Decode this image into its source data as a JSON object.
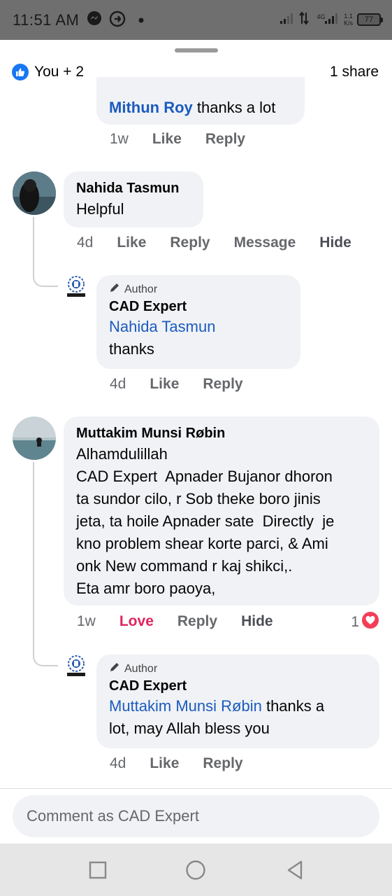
{
  "status_bar": {
    "time": "11:51 AM",
    "network": "4G",
    "speed_line1": "1.1",
    "speed_line2": "K/s",
    "battery": "77"
  },
  "reactions": {
    "summary": "You + 2",
    "shares": "1 share"
  },
  "top_reply": {
    "mention": "Mithun Roy",
    "text": " thanks a lot",
    "age": "1w",
    "like": "Like",
    "reply": "Reply"
  },
  "comments": [
    {
      "author": "Nahida Tasmun",
      "text": "Helpful",
      "age": "4d",
      "like": "Like",
      "reply": "Reply",
      "message": "Message",
      "hide": "Hide",
      "reply_item": {
        "badge": "Author",
        "author": "CAD Expert",
        "mention": "Nahida Tasmun",
        "text": "thanks",
        "age": "4d",
        "like": "Like",
        "reply": "Reply"
      }
    },
    {
      "author": "Muttakim Munsi Røbin",
      "lines": [
        "Alhamdulillah",
        "CAD Expert  Apnader Bujanor dhoron",
        "ta sundor cilo, r Sob theke boro jinis",
        "jeta, ta hoile Apnader sate  Directly  je",
        "kno problem shear korte parci, & Ami",
        "onk New command r kaj shikci,.",
        "Eta amr boro paoya,"
      ],
      "age": "1w",
      "love": "Love",
      "reply": "Reply",
      "hide": "Hide",
      "reaction_count": "1",
      "reply_item": {
        "badge": "Author",
        "author": "CAD Expert",
        "mention": "Muttakim Munsi Røbin",
        "text_line1": " thanks a",
        "text_line2": "lot, may Allah bless you",
        "age": "4d",
        "like": "Like",
        "reply": "Reply"
      }
    }
  ],
  "composer": {
    "placeholder": "Comment as CAD Expert"
  },
  "colors": {
    "mention": "#1b5bbf",
    "love": "#e0245e",
    "like_blue": "#1877f2",
    "bubble": "#f0f2f5"
  }
}
